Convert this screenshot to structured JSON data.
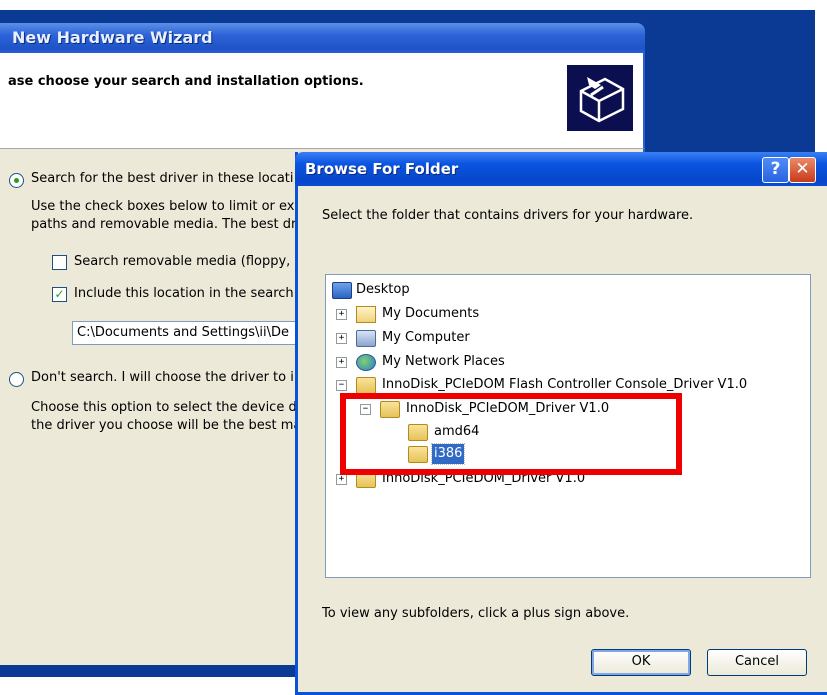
{
  "wizard": {
    "title": "New Hardware Wizard",
    "heading": "ase choose your search and installation options.",
    "option_search": "Search for the best driver in these locati",
    "search_desc_1": "Use the check boxes below to limit or ex",
    "search_desc_2": "paths and removable media. The best dr",
    "check_removable": "Search removable media (floppy, ",
    "check_include": "Include this location in the search",
    "path_value": "C:\\Documents and Settings\\ii\\De",
    "option_dont_search": "Don't search. I will choose the driver to i",
    "dont_desc_1": "Choose this option to select the device d",
    "dont_desc_2": "the driver you choose will be the best ma"
  },
  "dialog": {
    "title": "Browse For Folder",
    "help_label": "?",
    "close_label": "✕",
    "instruction": "Select the folder that contains drivers for your hardware.",
    "tree": [
      {
        "label": "Desktop",
        "icon": "desktop-icon"
      },
      {
        "label": "My Documents",
        "icon": "documents-folder-icon"
      },
      {
        "label": "My Computer",
        "icon": "computer-icon"
      },
      {
        "label": "My Network Places",
        "icon": "network-places-icon"
      },
      {
        "label": "InnoDisk_PCIeDOM Flash Controller Console_Driver V1.0",
        "icon": "folder-icon"
      },
      {
        "label": "InnoDisk_PCIeDOM_Driver V1.0",
        "icon": "open-folder-icon"
      },
      {
        "label": "amd64",
        "icon": "folder-icon"
      },
      {
        "label": "i386",
        "icon": "folder-icon",
        "selected": true
      },
      {
        "label": "InnoDisk_PCIeDOM_Driver V1.0",
        "icon": "folder-icon"
      }
    ],
    "expander_plus": "+",
    "expander_minus": "−",
    "hint": "To view any subfolders, click a plus sign above.",
    "ok_label": "OK",
    "cancel_label": "Cancel"
  },
  "colors": {
    "highlight_box": "#ee0000",
    "selection": "#316ac5",
    "titlebar": "#0a55e1"
  }
}
